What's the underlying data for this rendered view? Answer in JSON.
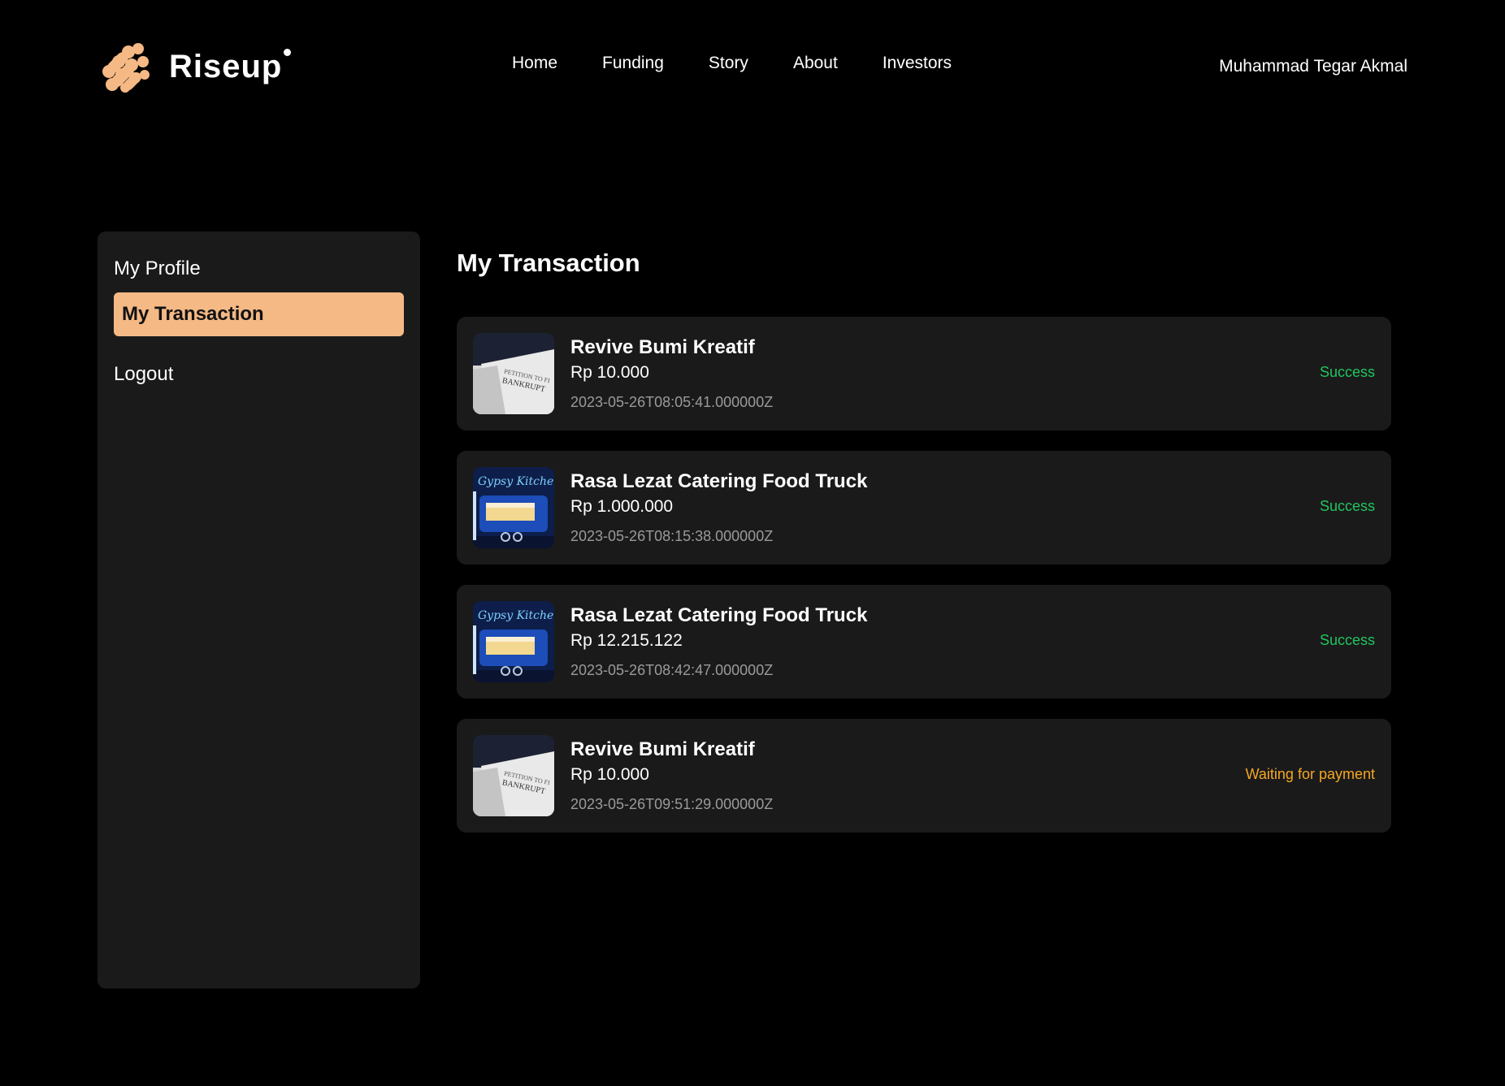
{
  "brand": {
    "name": "Riseup",
    "accent": "#f5b985"
  },
  "nav": {
    "items": [
      {
        "label": "Home"
      },
      {
        "label": "Funding"
      },
      {
        "label": "Story"
      },
      {
        "label": "About"
      },
      {
        "label": "Investors"
      }
    ]
  },
  "user": {
    "name": "Muhammad Tegar Akmal"
  },
  "sidebar": {
    "items": [
      {
        "label": "My Profile",
        "active": false
      },
      {
        "label": "My Transaction",
        "active": true
      },
      {
        "label": "Logout",
        "active": false
      }
    ]
  },
  "main": {
    "title": "My Transaction",
    "transactions": [
      {
        "title": "Revive Bumi Kreatif",
        "amount": "Rp 10.000",
        "date": "2023-05-26T08:05:41.000000Z",
        "status": "Success",
        "thumb": "bankruptcy-document"
      },
      {
        "title": "Rasa Lezat Catering Food Truck",
        "amount": "Rp 1.000.000",
        "date": "2023-05-26T08:15:38.000000Z",
        "status": "Success",
        "thumb": "food-truck"
      },
      {
        "title": "Rasa Lezat Catering Food Truck",
        "amount": "Rp 12.215.122",
        "date": "2023-05-26T08:42:47.000000Z",
        "status": "Success",
        "thumb": "food-truck"
      },
      {
        "title": "Revive Bumi Kreatif",
        "amount": "Rp 10.000",
        "date": "2023-05-26T09:51:29.000000Z",
        "status": "Waiting for payment",
        "thumb": "bankruptcy-document"
      }
    ]
  },
  "colors": {
    "success": "#22c55e",
    "waiting": "#f5a623"
  }
}
